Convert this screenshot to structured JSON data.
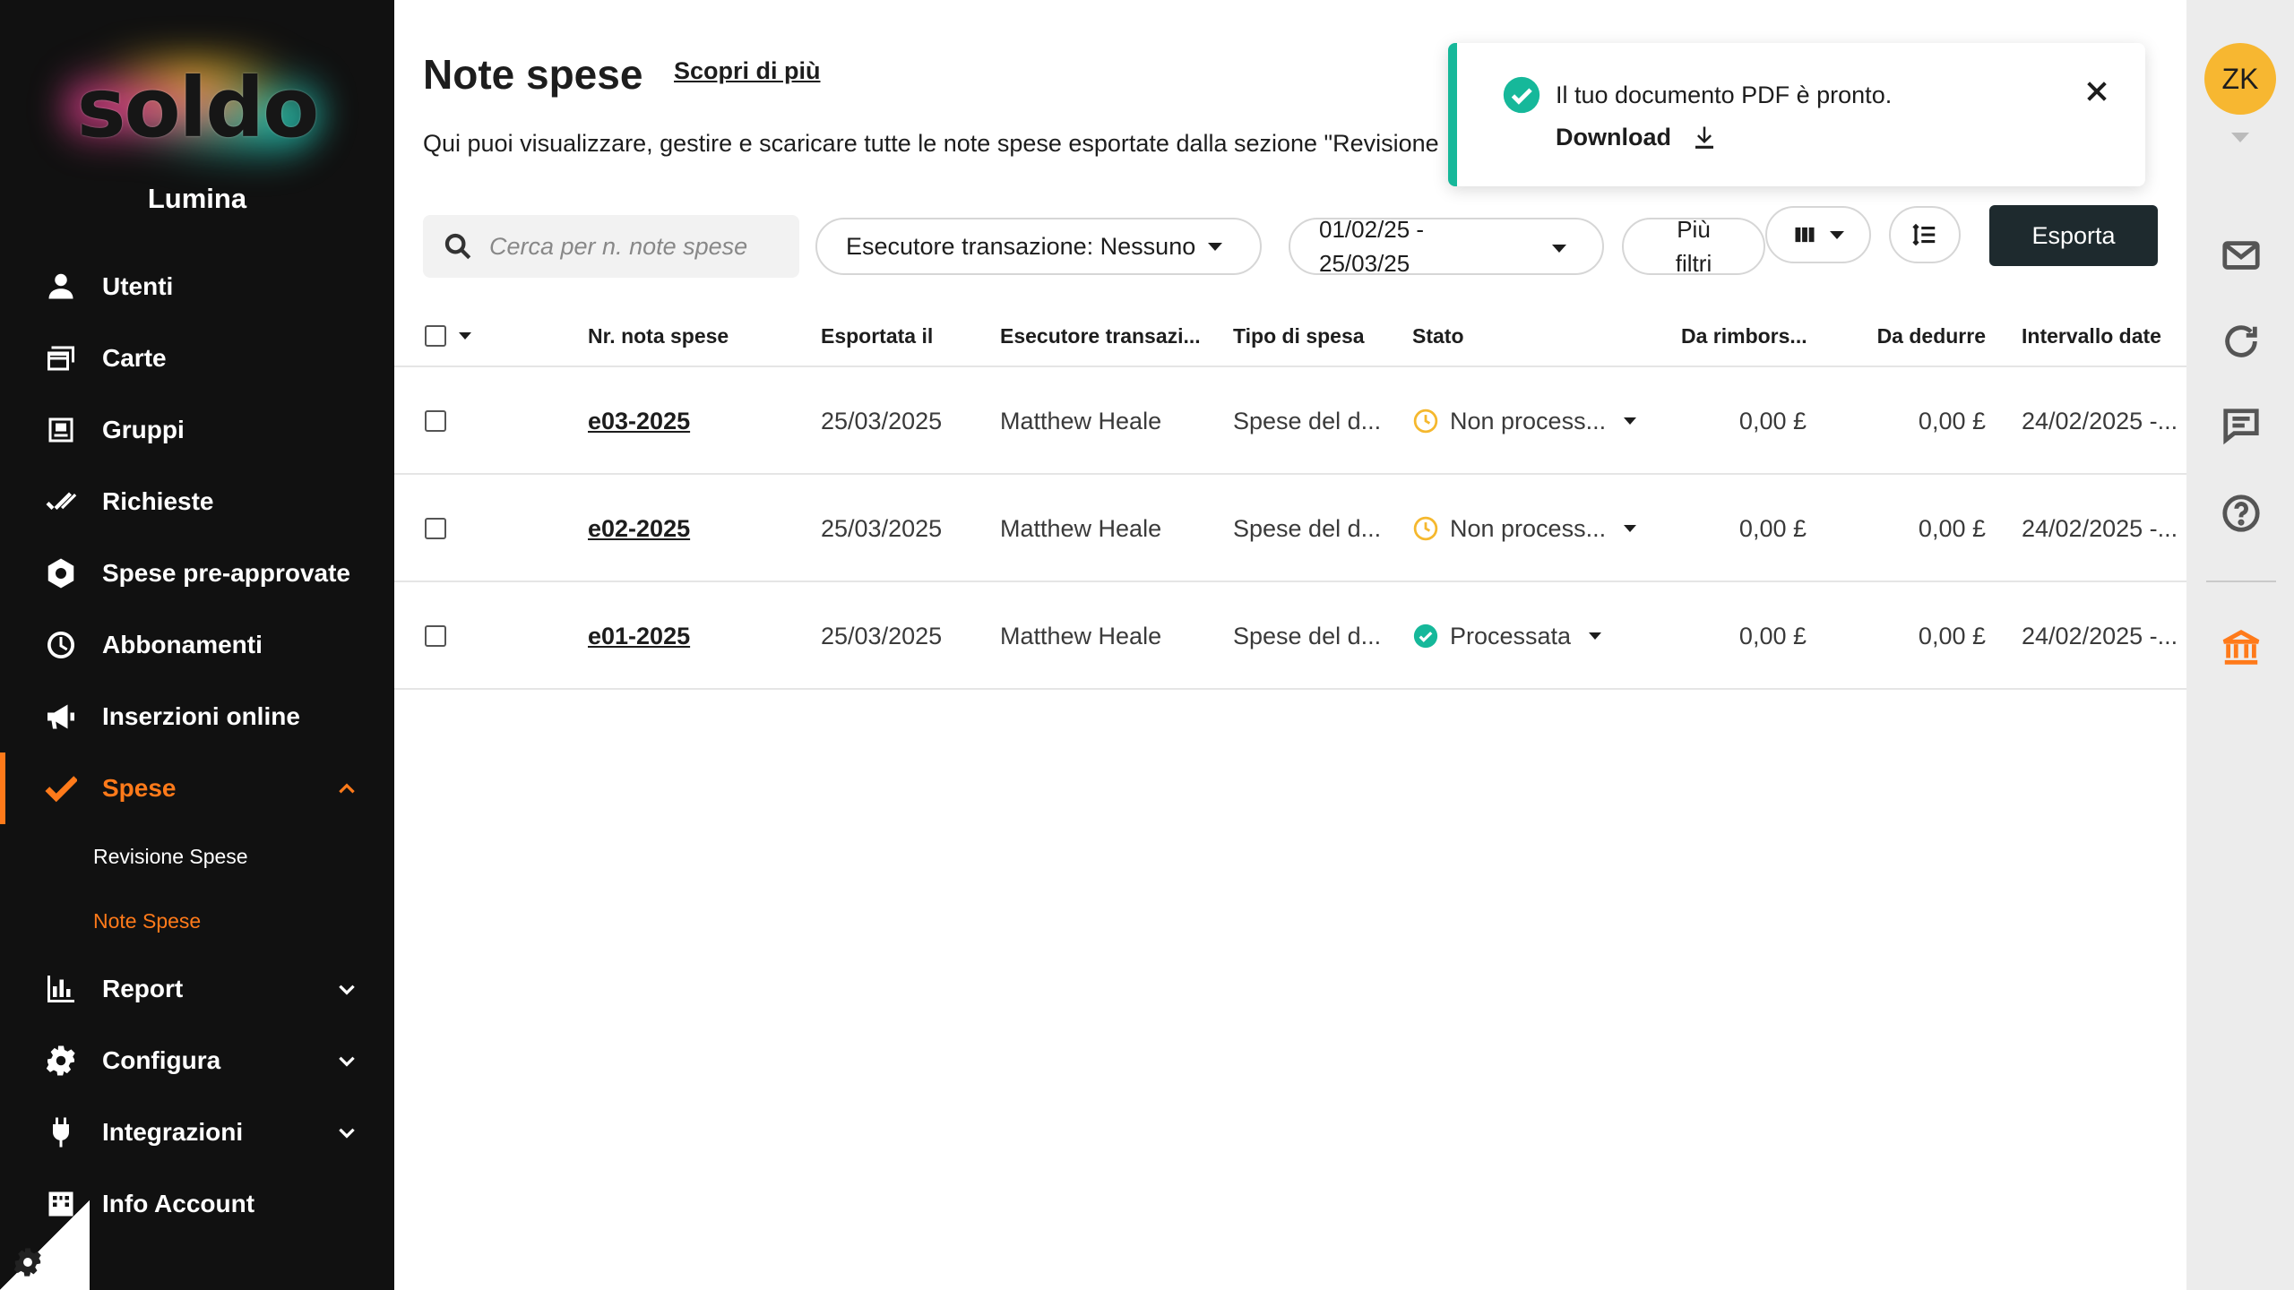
{
  "sidebar": {
    "logo_text": "soldo",
    "org_name": "Lumina",
    "items": [
      {
        "label": "Utenti"
      },
      {
        "label": "Carte"
      },
      {
        "label": "Gruppi"
      },
      {
        "label": "Richieste"
      },
      {
        "label": "Spese pre-approvate"
      },
      {
        "label": "Abbonamenti"
      },
      {
        "label": "Inserzioni online"
      },
      {
        "label": "Spese"
      },
      {
        "label": "Report"
      },
      {
        "label": "Configura"
      },
      {
        "label": "Integrazioni"
      },
      {
        "label": "Info Account"
      }
    ],
    "sub_items": [
      {
        "label": "Revisione Spese"
      },
      {
        "label": "Note Spese"
      }
    ],
    "accent_color": "#ff7a1a"
  },
  "header": {
    "title": "Note spese",
    "learn_more": "Scopri di più",
    "description": "Qui puoi visualizzare, gestire e scaricare tutte le note spese esportate dalla sezione \"Revisione"
  },
  "filters": {
    "search_placeholder": "Cerca per n. note spese",
    "executor": "Esecutore transazione: Nessuno",
    "date_line1": "01/02/25 -",
    "date_line2": "25/03/25",
    "more_line1": "Più",
    "more_line2": "filtri",
    "export_label": "Esporta"
  },
  "table": {
    "columns": [
      "Nr. nota spese",
      "Esportata il",
      "Esecutore transazi...",
      "Tipo di spesa",
      "Stato",
      "Da rimbors...",
      "Da dedurre",
      "Intervallo date"
    ],
    "rows": [
      {
        "number": "e03-2025",
        "exported": "25/03/2025",
        "executor": "Matthew Heale",
        "type": "Spese del d...",
        "status": "Non process...",
        "status_kind": "pending",
        "refund": "0,00 £",
        "deduct": "0,00 £",
        "range": "24/02/2025 -..."
      },
      {
        "number": "e02-2025",
        "exported": "25/03/2025",
        "executor": "Matthew Heale",
        "type": "Spese del d...",
        "status": "Non process...",
        "status_kind": "pending",
        "refund": "0,00 £",
        "deduct": "0,00 £",
        "range": "24/02/2025 -..."
      },
      {
        "number": "e01-2025",
        "exported": "25/03/2025",
        "executor": "Matthew Heale",
        "type": "Spese del d...",
        "status": "Processata",
        "status_kind": "done",
        "refund": "0,00 £",
        "deduct": "0,00 £",
        "range": "24/02/2025 -..."
      }
    ]
  },
  "toast": {
    "message": "Il tuo documento PDF è pronto.",
    "action": "Download",
    "accent_color": "#16b89a"
  },
  "rail": {
    "avatar_initials": "ZK",
    "icons": [
      "mail-icon",
      "refresh-icon",
      "chat-icon",
      "help-icon",
      "bank-icon"
    ]
  }
}
